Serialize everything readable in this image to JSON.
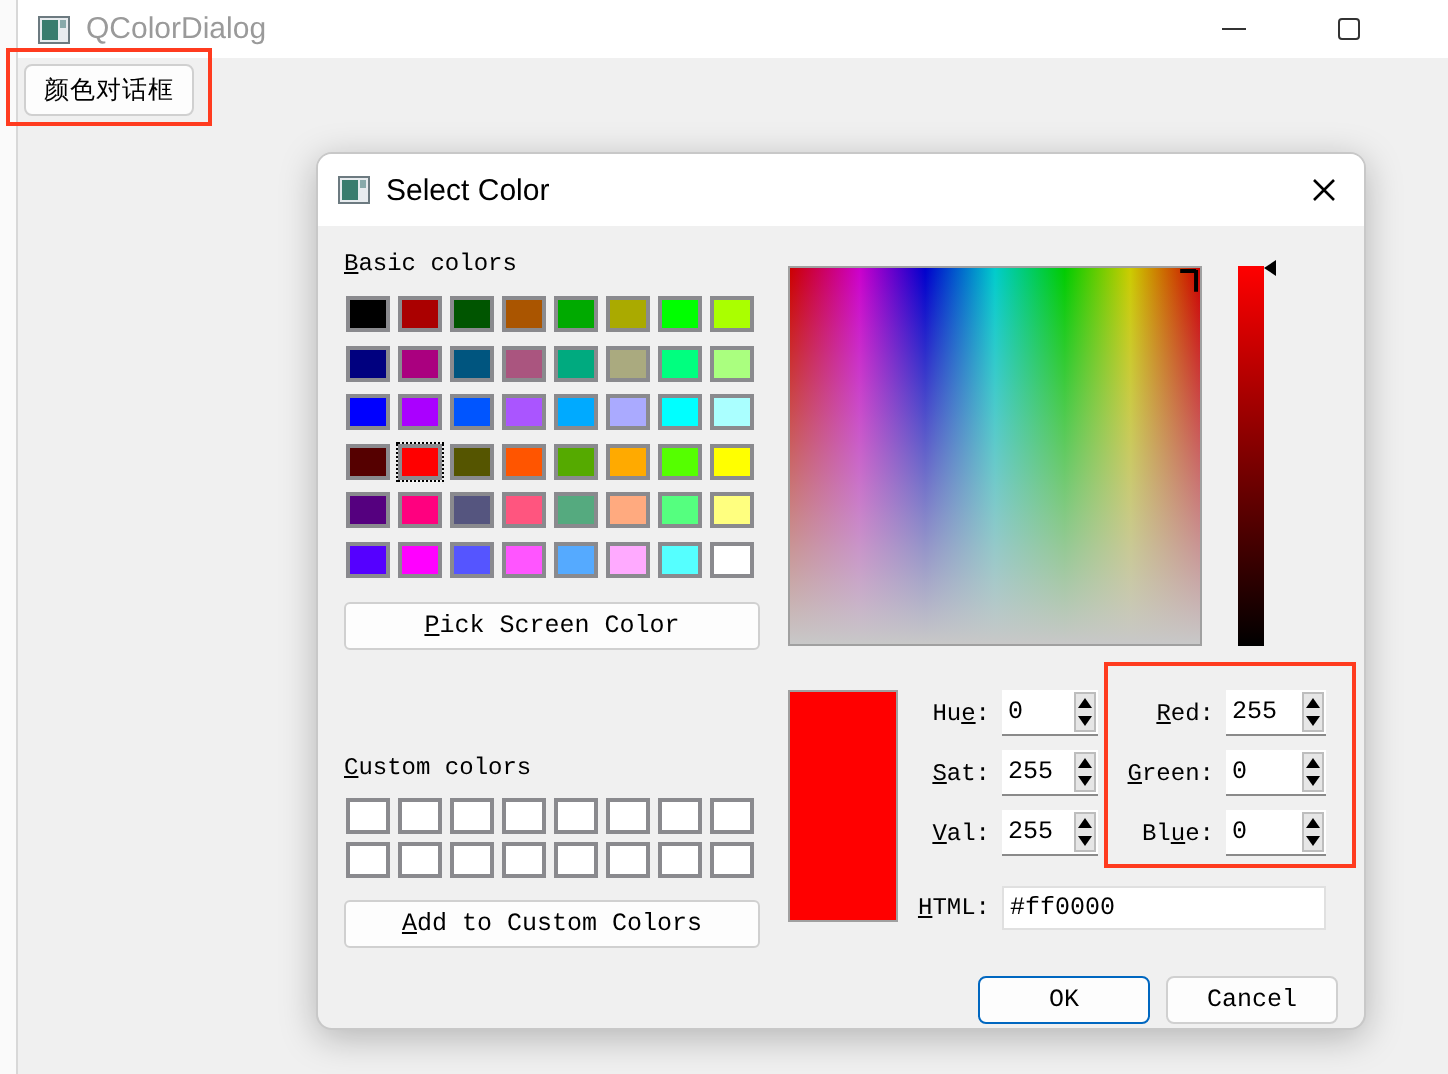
{
  "window": {
    "title": "QColorDialog"
  },
  "open_button": {
    "label": "颜色对话框",
    "highlighted": true
  },
  "dialog": {
    "title": "Select Color",
    "basic_colors_label": {
      "key": "B",
      "post": "asic colors"
    },
    "basic_colors": [
      {
        "color": "#000000",
        "selected": false
      },
      {
        "color": "#aa0000",
        "selected": false
      },
      {
        "color": "#005500",
        "selected": false
      },
      {
        "color": "#aa5500",
        "selected": false
      },
      {
        "color": "#00aa00",
        "selected": false
      },
      {
        "color": "#aaaa00",
        "selected": false
      },
      {
        "color": "#00ff00",
        "selected": false
      },
      {
        "color": "#aaff00",
        "selected": false
      },
      {
        "color": "#00007f",
        "selected": false
      },
      {
        "color": "#aa007f",
        "selected": false
      },
      {
        "color": "#00557f",
        "selected": false
      },
      {
        "color": "#aa557f",
        "selected": false
      },
      {
        "color": "#00aa7f",
        "selected": false
      },
      {
        "color": "#aaaa7f",
        "selected": false
      },
      {
        "color": "#00ff7f",
        "selected": false
      },
      {
        "color": "#aaff7f",
        "selected": false
      },
      {
        "color": "#0000ff",
        "selected": false
      },
      {
        "color": "#aa00ff",
        "selected": false
      },
      {
        "color": "#0055ff",
        "selected": false
      },
      {
        "color": "#aa55ff",
        "selected": false
      },
      {
        "color": "#00aaff",
        "selected": false
      },
      {
        "color": "#aaaaff",
        "selected": false
      },
      {
        "color": "#00ffff",
        "selected": false
      },
      {
        "color": "#aaffff",
        "selected": false
      },
      {
        "color": "#550000",
        "selected": false
      },
      {
        "color": "#ff0000",
        "selected": true
      },
      {
        "color": "#555500",
        "selected": false
      },
      {
        "color": "#ff5500",
        "selected": false
      },
      {
        "color": "#55aa00",
        "selected": false
      },
      {
        "color": "#ffaa00",
        "selected": false
      },
      {
        "color": "#55ff00",
        "selected": false
      },
      {
        "color": "#ffff00",
        "selected": false
      },
      {
        "color": "#55007f",
        "selected": false
      },
      {
        "color": "#ff007f",
        "selected": false
      },
      {
        "color": "#55557f",
        "selected": false
      },
      {
        "color": "#ff557f",
        "selected": false
      },
      {
        "color": "#55aa7f",
        "selected": false
      },
      {
        "color": "#ffaa7f",
        "selected": false
      },
      {
        "color": "#55ff7f",
        "selected": false
      },
      {
        "color": "#ffff7f",
        "selected": false
      },
      {
        "color": "#5500ff",
        "selected": false
      },
      {
        "color": "#ff00ff",
        "selected": false
      },
      {
        "color": "#5555ff",
        "selected": false
      },
      {
        "color": "#ff55ff",
        "selected": false
      },
      {
        "color": "#55aaff",
        "selected": false
      },
      {
        "color": "#ffaaff",
        "selected": false
      },
      {
        "color": "#55ffff",
        "selected": false
      },
      {
        "color": "#ffffff",
        "selected": false
      }
    ],
    "pick_button": {
      "key": "P",
      "post": "ick Screen Color"
    },
    "custom_colors_label": {
      "key": "C",
      "post": "ustom colors"
    },
    "custom_colors": [
      {
        "color": "#ffffff"
      },
      {
        "color": "#ffffff"
      },
      {
        "color": "#ffffff"
      },
      {
        "color": "#ffffff"
      },
      {
        "color": "#ffffff"
      },
      {
        "color": "#ffffff"
      },
      {
        "color": "#ffffff"
      },
      {
        "color": "#ffffff"
      },
      {
        "color": "#ffffff"
      },
      {
        "color": "#ffffff"
      },
      {
        "color": "#ffffff"
      },
      {
        "color": "#ffffff"
      },
      {
        "color": "#ffffff"
      },
      {
        "color": "#ffffff"
      },
      {
        "color": "#ffffff"
      },
      {
        "color": "#ffffff"
      }
    ],
    "add_button": {
      "key": "A",
      "post": "dd to Custom Colors"
    },
    "value_slider": {
      "level": 1
    },
    "current_color": {
      "color": "#ff0000"
    },
    "hsv_fields": [
      {
        "label": {
          "pre": "Hu",
          "key": "e",
          "post": ":"
        },
        "value": "0"
      },
      {
        "label": {
          "key": "S",
          "post": "at:"
        },
        "value": "255"
      },
      {
        "label": {
          "key": "V",
          "post": "al:"
        },
        "value": "255"
      }
    ],
    "rgb_fields": {
      "highlighted": true,
      "items": [
        {
          "label": {
            "key": "R",
            "post": "ed:"
          },
          "value": "255"
        },
        {
          "label": {
            "key": "G",
            "post": "reen:"
          },
          "value": "0"
        },
        {
          "label": {
            "pre": "Bl",
            "key": "u",
            "post": "e:"
          },
          "value": "0"
        }
      ]
    },
    "html_field": {
      "label": {
        "key": "H",
        "post": "TML:"
      },
      "value": "#ff0000"
    },
    "buttons": [
      {
        "label": "OK",
        "default": true
      },
      {
        "label": "Cancel",
        "default": false
      }
    ]
  }
}
